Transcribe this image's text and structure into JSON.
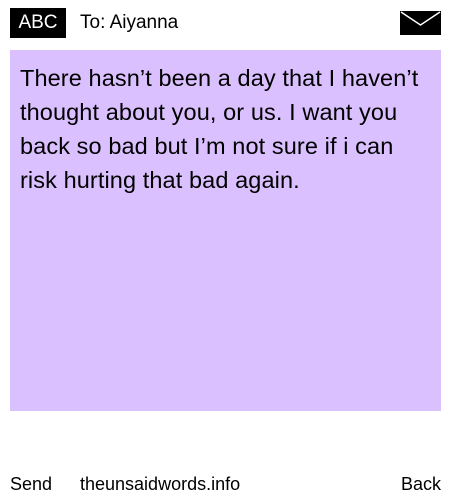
{
  "header": {
    "mode_label": "ABC",
    "recipient": "To: Aiyanna",
    "icon": "envelope-icon"
  },
  "message": {
    "text": "There hasn’t been a day that I haven’t thought about you, or us. I want you back so bad but I’m not sure if i can risk hurting that bad again."
  },
  "footer": {
    "send_label": "Send",
    "site_label": "theunsaidwords.info",
    "back_label": "Back"
  },
  "colors": {
    "message_background": "#dbc0ff",
    "header_badge": "#000000"
  }
}
